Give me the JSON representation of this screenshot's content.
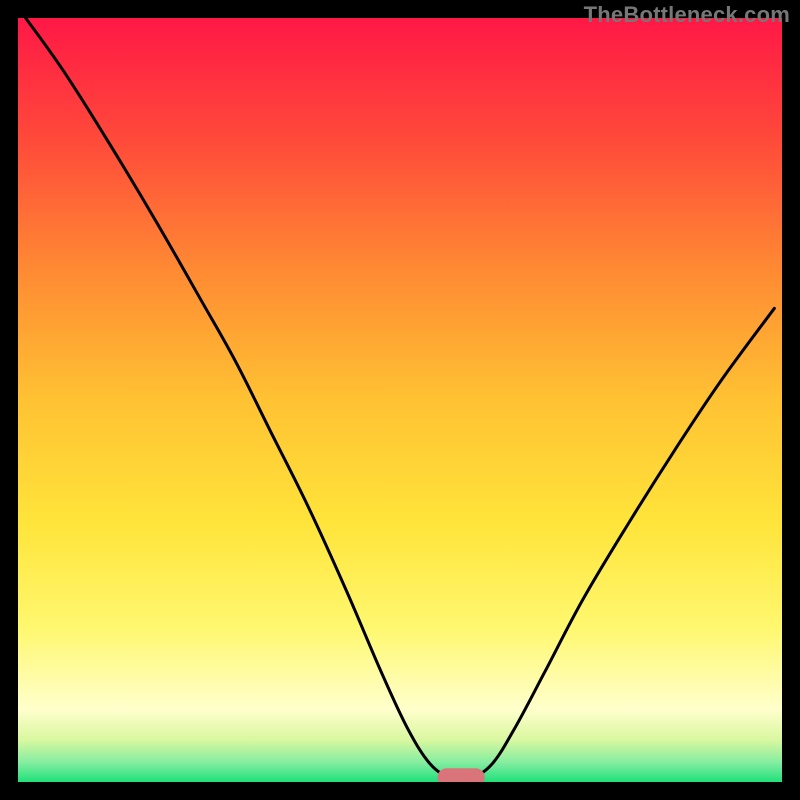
{
  "watermark": "TheBottleneck.com",
  "chart_data": {
    "type": "line",
    "title": "",
    "xlabel": "",
    "ylabel": "",
    "xlim": [
      0,
      100
    ],
    "ylim": [
      0,
      100
    ],
    "curve": [
      {
        "x": 1.0,
        "y": 100.0
      },
      {
        "x": 6.0,
        "y": 93.0
      },
      {
        "x": 12.0,
        "y": 83.5
      },
      {
        "x": 18.0,
        "y": 73.5
      },
      {
        "x": 24.0,
        "y": 63.0
      },
      {
        "x": 28.5,
        "y": 55.0
      },
      {
        "x": 33.0,
        "y": 46.0
      },
      {
        "x": 38.0,
        "y": 36.0
      },
      {
        "x": 43.0,
        "y": 25.0
      },
      {
        "x": 47.5,
        "y": 14.5
      },
      {
        "x": 51.0,
        "y": 7.0
      },
      {
        "x": 54.0,
        "y": 2.3
      },
      {
        "x": 56.7,
        "y": 0.6
      },
      {
        "x": 59.3,
        "y": 0.6
      },
      {
        "x": 62.0,
        "y": 2.3
      },
      {
        "x": 65.0,
        "y": 7.0
      },
      {
        "x": 69.0,
        "y": 14.5
      },
      {
        "x": 74.0,
        "y": 24.0
      },
      {
        "x": 80.0,
        "y": 34.0
      },
      {
        "x": 86.0,
        "y": 43.5
      },
      {
        "x": 92.0,
        "y": 52.5
      },
      {
        "x": 99.0,
        "y": 62.0
      }
    ],
    "marker": {
      "x": 58.0,
      "y": 0.6,
      "rx": 3.1,
      "ry": 1.2,
      "color": "#d9757a"
    },
    "background_gradient": [
      {
        "pos": 0.0,
        "color": "#ff1846"
      },
      {
        "pos": 0.16,
        "color": "#ff4a3a"
      },
      {
        "pos": 0.33,
        "color": "#ff8a33"
      },
      {
        "pos": 0.5,
        "color": "#ffc233"
      },
      {
        "pos": 0.66,
        "color": "#ffe43a"
      },
      {
        "pos": 0.8,
        "color": "#fff870"
      },
      {
        "pos": 0.905,
        "color": "#ffffcc"
      },
      {
        "pos": 0.945,
        "color": "#d9f7a0"
      },
      {
        "pos": 0.975,
        "color": "#83eda0"
      },
      {
        "pos": 1.0,
        "color": "#1fe07a"
      }
    ],
    "frame_color": "#000000",
    "curve_color": "#000000"
  }
}
